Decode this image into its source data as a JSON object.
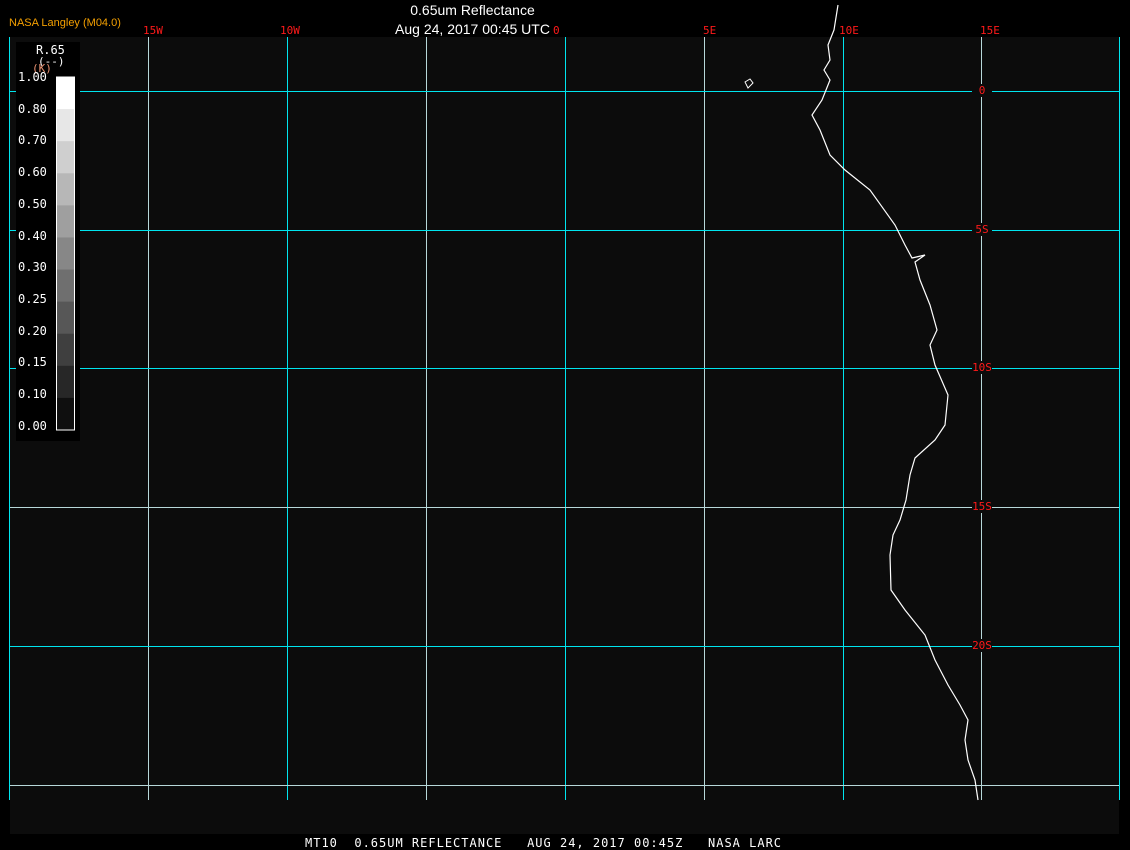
{
  "header": {
    "title": "0.65um Reflectance",
    "subtitle": "Aug 24, 2017 00:45 UTC",
    "brand": "NASA Langley (M04.0)"
  },
  "map": {
    "background": "#0c0c0c",
    "grid_color": "#00e5ee",
    "coast_color": "#ffffff",
    "label_color": "#ff1a1a",
    "lon_labels": [
      "15W",
      "10W",
      "0",
      "5E",
      "10E",
      "15E"
    ],
    "lat_labels": [
      "0",
      "5S",
      "10S",
      "15S",
      "20S"
    ]
  },
  "colorbar": {
    "title": "R.65",
    "unit": "(--)",
    "unit_overlay": "(K)",
    "ticks": [
      "1.00",
      "0.80",
      "0.70",
      "0.60",
      "0.50",
      "0.40",
      "0.30",
      "0.25",
      "0.20",
      "0.15",
      "0.10",
      "0.00"
    ]
  },
  "footer": {
    "text": "MT10  0.65UM REFLECTANCE   AUG 24, 2017 00:45Z   NASA LARC"
  }
}
